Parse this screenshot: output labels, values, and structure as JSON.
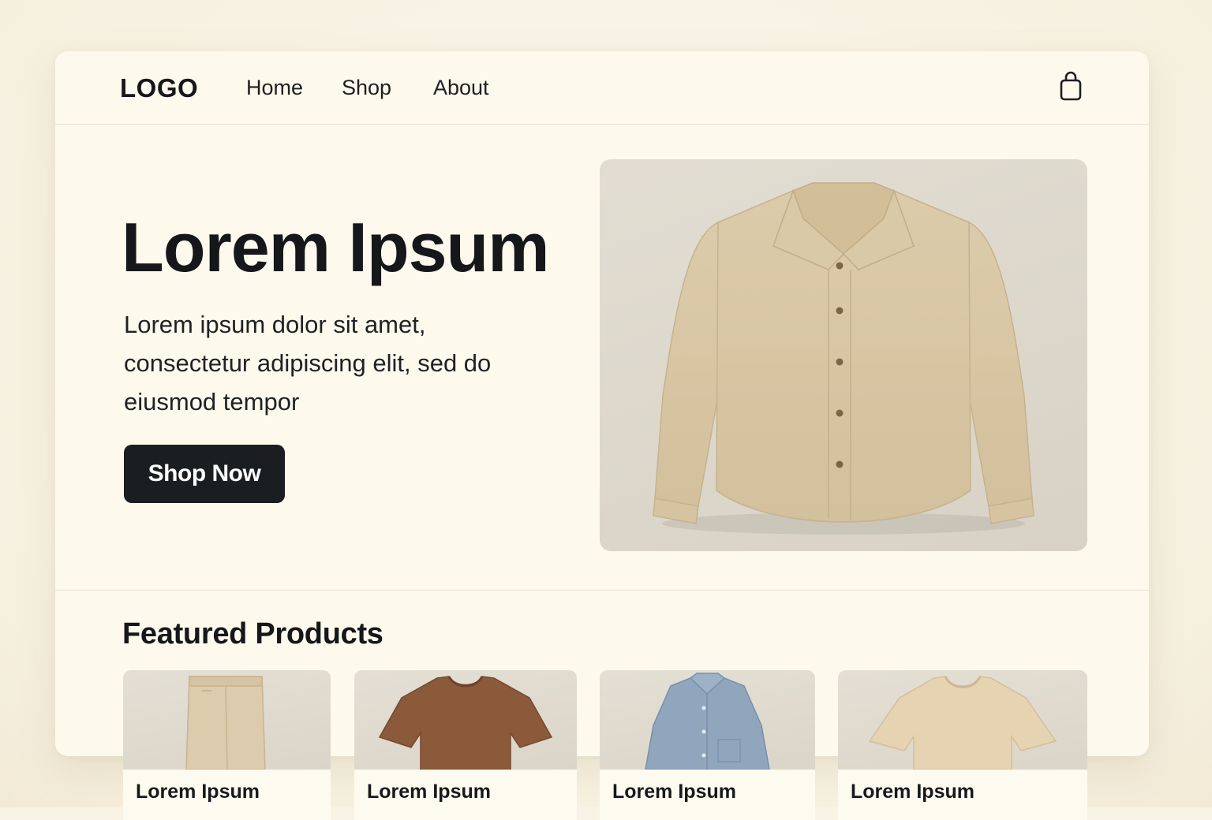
{
  "header": {
    "logo": "LOGO",
    "nav": [
      {
        "label": "Home"
      },
      {
        "label": "Shop"
      },
      {
        "label": "About"
      }
    ],
    "cart_icon": "shopping-bag-icon"
  },
  "hero": {
    "title": "Lorem Ipsum",
    "text": "Lorem ipsum dolor sit amet, consectetur adipiscing elit, sed do eiusmod tempor",
    "button_label": "Shop Now",
    "image": "beige-button-up-shirt"
  },
  "featured": {
    "title": "Featured Products",
    "products": [
      {
        "name": "Lorem Ipsum",
        "image": "beige-trousers"
      },
      {
        "name": "Lorem Ipsum",
        "image": "brown-t-shirt"
      },
      {
        "name": "Lorem Ipsum",
        "image": "blue-button-up-shirt"
      },
      {
        "name": "Lorem Ipsum",
        "image": "beige-t-shirt"
      }
    ]
  },
  "colors": {
    "page_bg": "#fdf9ec",
    "button_bg": "#1b1e20",
    "text": "#15171a"
  }
}
